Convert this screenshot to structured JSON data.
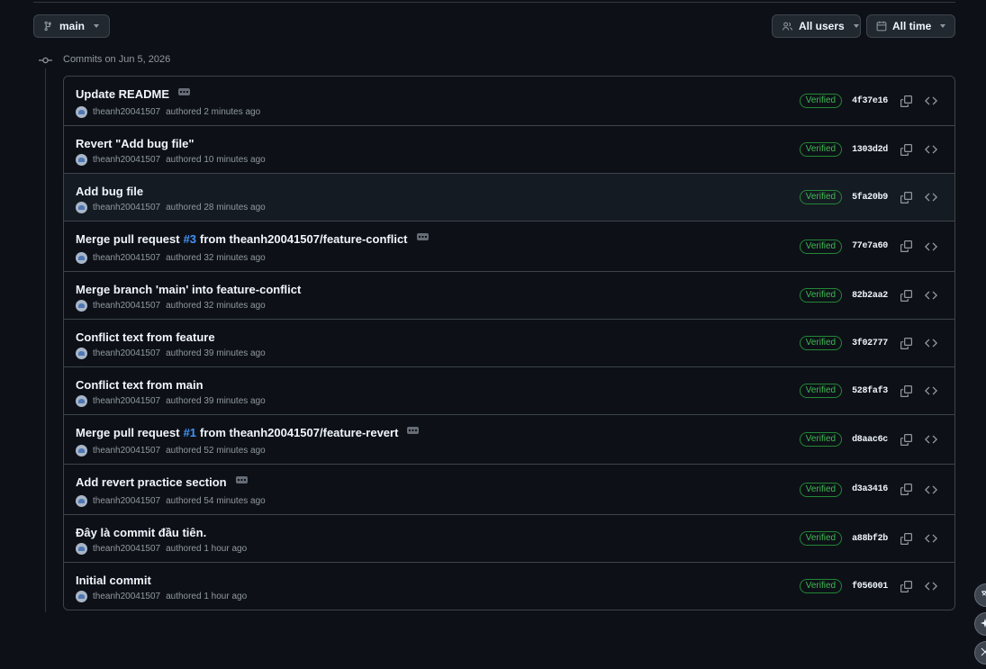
{
  "toolbar": {
    "branch_label": "main",
    "users_label": "All users",
    "time_label": "All time"
  },
  "date_header": "Commits on Jun 5, 2026",
  "commits": [
    {
      "title": "Update README",
      "pr": "",
      "title_suffix": "",
      "has_ellipsis": true,
      "author": "theanh20041507",
      "time": "authored 2 minutes ago",
      "verified": "Verified",
      "sha": "4f37e16"
    },
    {
      "title": "Revert \"Add bug file\"",
      "pr": "",
      "title_suffix": "",
      "has_ellipsis": false,
      "author": "theanh20041507",
      "time": "authored 10 minutes ago",
      "verified": "Verified",
      "sha": "1303d2d"
    },
    {
      "title": "Add bug file",
      "pr": "",
      "title_suffix": "",
      "has_ellipsis": false,
      "author": "theanh20041507",
      "time": "authored 28 minutes ago",
      "verified": "Verified",
      "sha": "5fa20b9"
    },
    {
      "title": "Merge pull request",
      "pr": "#3",
      "title_suffix": "from theanh20041507/feature-conflict",
      "has_ellipsis": true,
      "author": "theanh20041507",
      "time": "authored 32 minutes ago",
      "verified": "Verified",
      "sha": "77e7a60"
    },
    {
      "title": "Merge branch 'main' into feature-conflict",
      "pr": "",
      "title_suffix": "",
      "has_ellipsis": false,
      "author": "theanh20041507",
      "time": "authored 32 minutes ago",
      "verified": "Verified",
      "sha": "82b2aa2"
    },
    {
      "title": "Conflict text from feature",
      "pr": "",
      "title_suffix": "",
      "has_ellipsis": false,
      "author": "theanh20041507",
      "time": "authored 39 minutes ago",
      "verified": "Verified",
      "sha": "3f02777"
    },
    {
      "title": "Conflict text from main",
      "pr": "",
      "title_suffix": "",
      "has_ellipsis": false,
      "author": "theanh20041507",
      "time": "authored 39 minutes ago",
      "verified": "Verified",
      "sha": "528faf3"
    },
    {
      "title": "Merge pull request",
      "pr": "#1",
      "title_suffix": "from theanh20041507/feature-revert",
      "has_ellipsis": true,
      "author": "theanh20041507",
      "time": "authored 52 minutes ago",
      "verified": "Verified",
      "sha": "d8aac6c"
    },
    {
      "title": "Add revert practice section",
      "pr": "",
      "title_suffix": "",
      "has_ellipsis": true,
      "author": "theanh20041507",
      "time": "authored 54 minutes ago",
      "verified": "Verified",
      "sha": "d3a3416"
    },
    {
      "title": "Đây là commit đầu tiên.",
      "pr": "",
      "title_suffix": "",
      "has_ellipsis": false,
      "author": "theanh20041507",
      "time": "authored 1 hour ago",
      "verified": "Verified",
      "sha": "a88bf2b"
    },
    {
      "title": "Initial commit",
      "pr": "",
      "title_suffix": "",
      "has_ellipsis": false,
      "author": "theanh20041507",
      "time": "authored 1 hour ago",
      "verified": "Verified",
      "sha": "f056001"
    }
  ],
  "colors": {
    "background": "#0d1117",
    "border": "#3d444d",
    "verified_green": "#3fb950",
    "link_blue": "#4493f8",
    "highlight_row": "#151b23"
  },
  "icons": {
    "branch": "git-branch-icon",
    "users": "people-icon",
    "calendar": "calendar-icon",
    "commit": "git-commit-icon",
    "copy": "copy-icon",
    "browse": "code-icon"
  }
}
